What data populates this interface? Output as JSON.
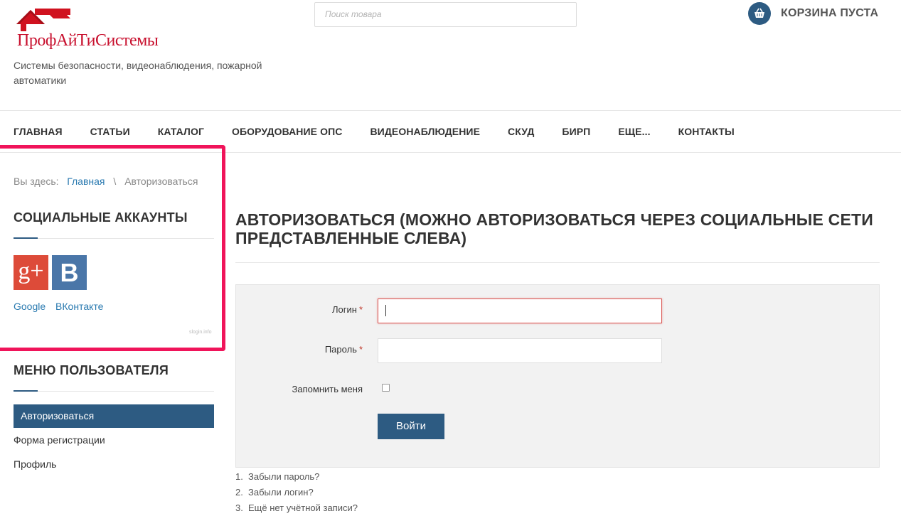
{
  "header": {
    "logo_text": "ПрофАйТиСистемы",
    "tagline": "Системы безопасности, видеонаблюдения, пожарной автоматики",
    "search_placeholder": "Поиск товара",
    "cart_label": "КОРЗИНА ПУСТА"
  },
  "nav": {
    "items": [
      "ГЛАВНАЯ",
      "СТАТЬИ",
      "КАТАЛОГ",
      "ОБОРУДОВАНИЕ ОПС",
      "ВИДЕОНАБЛЮДЕНИЕ",
      "СКУД",
      "БИРП",
      "ЕЩЕ...",
      "КОНТАКТЫ"
    ]
  },
  "breadcrumb": {
    "prefix": "Вы здесь:",
    "home": "Главная",
    "separator": "\\",
    "current": "Авторизоваться"
  },
  "social": {
    "title": "СОЦИАЛЬНЫЕ АККАУНТЫ",
    "google_icon_text": "g+",
    "vk_icon_text": "B",
    "links": [
      "Google",
      "ВКонтакте"
    ],
    "credit": "slogin.info"
  },
  "user_menu": {
    "title": "МЕНЮ ПОЛЬЗОВАТЕЛЯ",
    "items": [
      "Авторизоваться",
      "Форма регистрации",
      "Профиль"
    ],
    "active_index": 0
  },
  "main": {
    "title": "АВТОРИЗОВАТЬСЯ (МОЖНО АВТОРИЗОВАТЬСЯ ЧЕРЕЗ СОЦИАЛЬНЫЕ СЕТИ ПРЕДСТАВЛЕННЫЕ СЛЕВА)",
    "login_label": "Логин",
    "password_label": "Пароль",
    "required_mark": "*",
    "login_value": "",
    "password_value": "",
    "remember_label": "Запомнить меня",
    "remember_checked": false,
    "submit_label": "Войти",
    "links": [
      {
        "num": "1.",
        "text": "Забыли пароль?"
      },
      {
        "num": "2.",
        "text": "Забыли логин?"
      },
      {
        "num": "3.",
        "text": "Ещё нет учётной записи?"
      }
    ]
  },
  "colors": {
    "brand_red": "#c8102e",
    "primary_blue": "#2d5b82",
    "link_blue": "#2a7ab0",
    "highlight_pink": "#f0145a",
    "required_red": "#c0392b"
  }
}
